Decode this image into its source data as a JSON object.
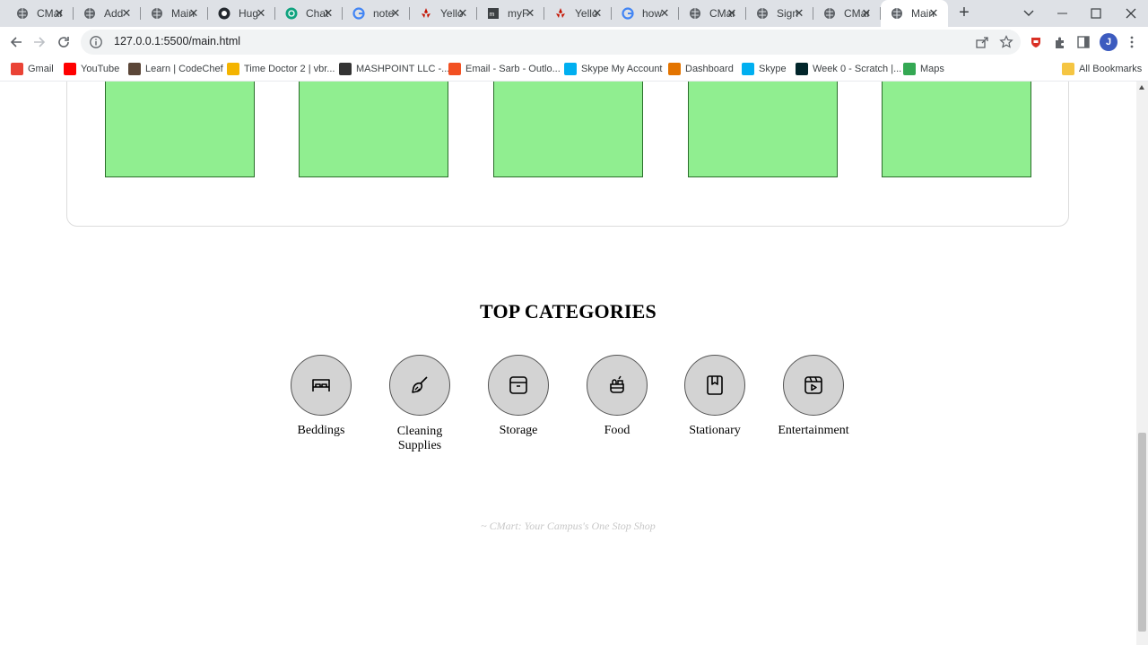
{
  "browser": {
    "tabs": [
      {
        "title": "CMart",
        "icon": "globe-icon"
      },
      {
        "title": "Add",
        "icon": "globe-icon"
      },
      {
        "title": "Main",
        "icon": "globe-icon"
      },
      {
        "title": "Hug",
        "icon": "github-icon"
      },
      {
        "title": "Chat",
        "icon": "chatgpt-icon"
      },
      {
        "title": "note",
        "icon": "google-icon"
      },
      {
        "title": "Yello",
        "icon": "yelp-icon"
      },
      {
        "title": "myF",
        "icon": "myf-icon"
      },
      {
        "title": "Yello",
        "icon": "yelp-icon"
      },
      {
        "title": "how",
        "icon": "google-icon"
      },
      {
        "title": "CMart",
        "icon": "globe-icon"
      },
      {
        "title": "Sign",
        "icon": "globe-icon"
      },
      {
        "title": "CMart",
        "icon": "globe-icon"
      },
      {
        "title": "Main",
        "icon": "globe-icon",
        "active": true
      }
    ],
    "url": "127.0.0.1:5500/main.html",
    "profile_initial": "J",
    "bookmarks": [
      {
        "label": "Gmail",
        "icon": "gmail-icon",
        "color": "#ea4335"
      },
      {
        "label": "YouTube",
        "icon": "youtube-icon",
        "color": "#ff0000"
      },
      {
        "label": "Learn | CodeChef",
        "icon": "codechef-icon",
        "color": "#5b4638"
      },
      {
        "label": "Time Doctor 2 | vbr...",
        "icon": "timedoctor-icon",
        "color": "#f4b400"
      },
      {
        "label": "MASHPOINT LLC -...",
        "icon": "mashpoint-icon",
        "color": "#333333"
      },
      {
        "label": "Email - Sarb - Outlo...",
        "icon": "microsoft-icon",
        "color": "#f25022"
      },
      {
        "label": "Skype My Account",
        "icon": "skype-icon",
        "color": "#00aff0"
      },
      {
        "label": "Dashboard",
        "icon": "dashboard-icon",
        "color": "#e37400"
      },
      {
        "label": "Skype",
        "icon": "skype-icon",
        "color": "#00aff0"
      },
      {
        "label": "Week 0 - Scratch |...",
        "icon": "edx-icon",
        "color": "#02262b"
      },
      {
        "label": "Maps",
        "icon": "maps-icon",
        "color": "#34a853"
      }
    ],
    "all_bookmarks_label": "All Bookmarks"
  },
  "page": {
    "product_cards_count": 5,
    "card_color": "#90ee90",
    "categories_title": "TOP CATEGORIES",
    "categories": [
      {
        "label": "Beddings",
        "icon": "bed-icon"
      },
      {
        "label": "Cleaning Supplies",
        "icon": "broom-icon"
      },
      {
        "label": "Storage",
        "icon": "archive-box-icon"
      },
      {
        "label": "Food",
        "icon": "food-icon"
      },
      {
        "label": "Stationary",
        "icon": "notebook-icon"
      },
      {
        "label": "Entertainment",
        "icon": "clapperboard-icon"
      }
    ],
    "footer_tagline": "~ CMart: Your Campus's One Stop Shop"
  }
}
